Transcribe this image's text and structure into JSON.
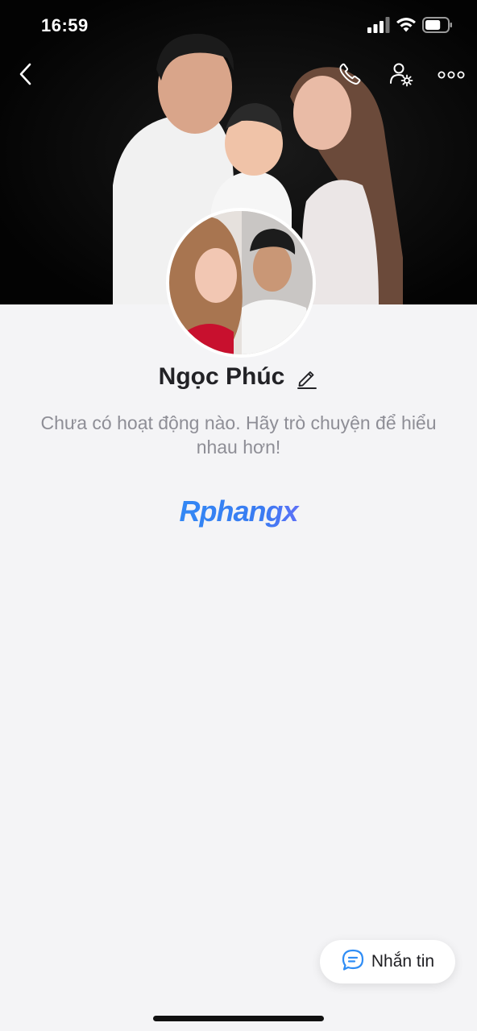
{
  "status_bar": {
    "time": "16:59",
    "battery_level": 0.7
  },
  "header": {
    "back_icon": "chevron-left-icon",
    "call_icon": "phone-icon",
    "settings_icon": "user-settings-icon",
    "more_icon": "more-horizontal-icon"
  },
  "profile": {
    "name": "Ngọc Phúc",
    "edit_icon": "pencil-icon",
    "empty_message": "Chưa có hoạt động nào. Hãy trò chuyện để hiểu nhau hơn!"
  },
  "watermark": {
    "text": "Rphangx"
  },
  "message_button": {
    "label": "Nhắn tin",
    "icon": "chat-bubble-icon"
  },
  "colors": {
    "background": "#f4f4f6",
    "accent": "#2f8df5",
    "text_primary": "#222226",
    "text_muted": "#8e8e96"
  }
}
